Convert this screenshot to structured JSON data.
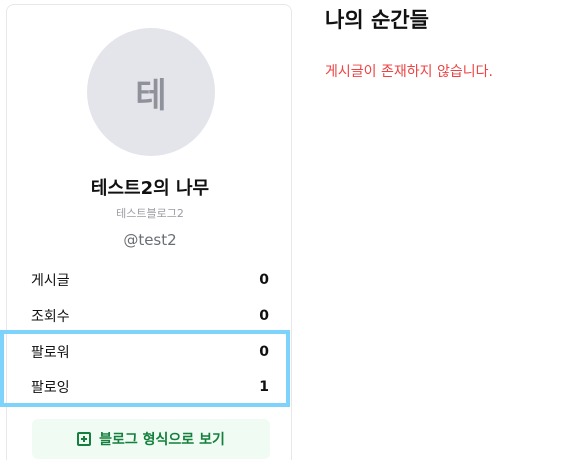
{
  "profile": {
    "avatar_initial": "테",
    "blog_name": "테스트2의 나무",
    "blog_subtitle": "테스트블로그2",
    "handle": "@test2"
  },
  "stats": [
    {
      "label": "게시글",
      "value": "0"
    },
    {
      "label": "조회수",
      "value": "0"
    },
    {
      "label": "팔로워",
      "value": "0"
    },
    {
      "label": "팔로잉",
      "value": "1"
    }
  ],
  "blog_view_button": {
    "label": "블로그 형식으로 보기",
    "icon": "plus-square-icon"
  },
  "main": {
    "title": "나의 순간들",
    "empty_message": "게시글이 존재하지 않습니다."
  },
  "colors": {
    "accent_green": "#15803d",
    "button_bg": "#f0fbf3",
    "error_red": "#ef4444",
    "highlight_blue": "#7dd3fc",
    "avatar_bg": "#e4e5ea"
  }
}
